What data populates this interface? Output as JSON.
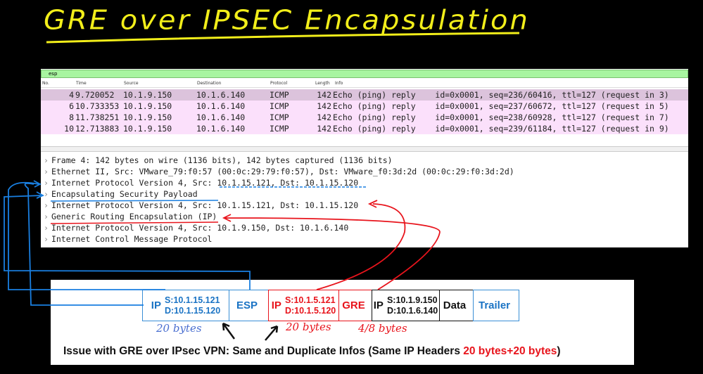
{
  "title": "GRE over IPSEC Encapsulation",
  "filter": {
    "value": "esp"
  },
  "columns": [
    "No.",
    "Time",
    "Source",
    "Destination",
    "Protocol",
    "Length",
    "Info"
  ],
  "packets": [
    {
      "no": "4",
      "time": "9.720052",
      "src": "10.1.9.150",
      "dst": "10.1.6.140",
      "proto": "ICMP",
      "len": "142",
      "info": "Echo (ping) reply    id=0x0001, seq=236/60416, ttl=127 (request in 3)"
    },
    {
      "no": "6",
      "time": "10.733353",
      "src": "10.1.9.150",
      "dst": "10.1.6.140",
      "proto": "ICMP",
      "len": "142",
      "info": "Echo (ping) reply    id=0x0001, seq=237/60672, ttl=127 (request in 5)"
    },
    {
      "no": "8",
      "time": "11.738251",
      "src": "10.1.9.150",
      "dst": "10.1.6.140",
      "proto": "ICMP",
      "len": "142",
      "info": "Echo (ping) reply    id=0x0001, seq=238/60928, ttl=127 (request in 7)"
    },
    {
      "no": "10",
      "time": "12.713883",
      "src": "10.1.9.150",
      "dst": "10.1.6.140",
      "proto": "ICMP",
      "len": "142",
      "info": "Echo (ping) reply    id=0x0001, seq=239/61184, ttl=127 (request in 9)"
    }
  ],
  "details": [
    "Frame 4: 142 bytes on wire (1136 bits), 142 bytes captured (1136 bits)",
    "Ethernet II, Src: VMware_79:f0:57 (00:0c:29:79:f0:57), Dst: VMware_f0:3d:2d (00:0c:29:f0:3d:2d)",
    "Internet Protocol Version 4, Src: 10.1.15.121, Dst: 10.1.15.120",
    "Encapsulating Security Payload",
    "Internet Protocol Version 4, Src: 10.1.15.121, Dst: 10.1.15.120",
    "Generic Routing Encapsulation (IP)",
    "Internet Protocol Version 4, Src: 10.1.9.150, Dst: 10.1.6.140",
    "Internet Control Message Protocol"
  ],
  "diagram": {
    "outer_ip": {
      "label": "IP",
      "src": "S:10.1.15.121",
      "dst": "D:10.1.15.120"
    },
    "esp": "ESP",
    "gre_ip": {
      "label": "IP",
      "src": "S:10.1.5.121",
      "dst": "D:10.1.5.120"
    },
    "gre": "GRE",
    "inner_ip": {
      "label": "IP",
      "src": "S:10.1.9.150",
      "dst": "D:10.1.6.140"
    },
    "data": "Data",
    "trailer": "Trailer",
    "note_outer": "20 bytes",
    "note_gre_ip": "20 bytes",
    "note_gre": "4/8 bytes",
    "issue_text": "Issue with GRE over IPsec VPN: Same and Duplicate Infos (Same IP Headers ",
    "issue_highlight": "20 bytes+20 bytes",
    "issue_end": ")"
  },
  "colors": {
    "title": "#f2ee1a",
    "blue": "#1a73c4",
    "red": "#e8141c",
    "filter_bg": "#a8f5a0",
    "row_bg": "#fbe0fb"
  }
}
